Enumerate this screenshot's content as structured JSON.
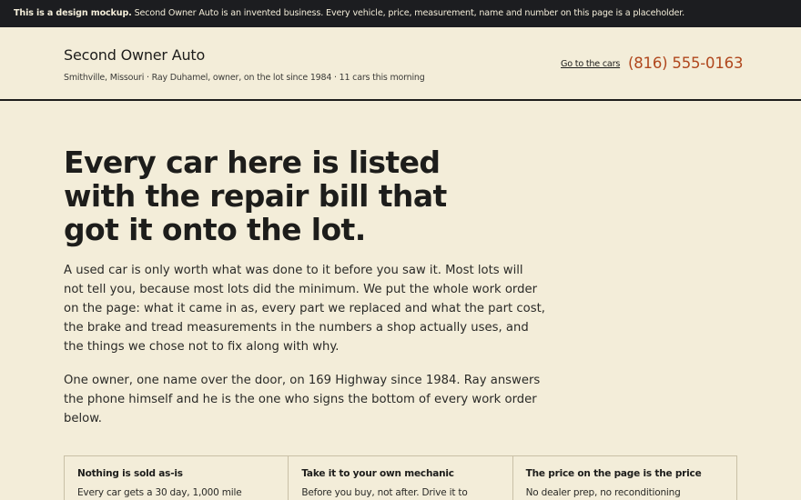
{
  "banner": {
    "lead": "This is a design mockup.",
    "text": "Second Owner Auto is an invented business. Every vehicle, price, measurement, name and number on this page is a placeholder."
  },
  "header": {
    "brand": "Second Owner Auto",
    "subline": "Smithville, Missouri · Ray Duhamel, owner, on the lot since 1984 · 11 cars this morning",
    "nav_link": "Go to the cars",
    "phone": "(816) 555-0163",
    "accent_color": "#b0471d"
  },
  "hero": {
    "title_lines": [
      "Every car here is listed",
      "with the repair bill that",
      "got it onto the lot."
    ],
    "para1_lines": [
      "A used car is only worth what was done to it before you saw it. Most lots will",
      "not tell you, because most lots did the minimum. We put the whole work order",
      "on the page: what it came in as, every part we replaced and what the part cost,",
      "the brake and tread measurements in the numbers a shop actually uses, and",
      "the things we chose not to fix along with why."
    ],
    "para2_lines": [
      "One owner, one name over the door, on 169 Highway since 1984. Ray answers",
      "the phone himself and he is the one who signs the bottom of every work order",
      "below."
    ]
  },
  "features": [
    {
      "title": "Nothing is sold as-is",
      "text": "Every car gets a 30 day, 1,000 mile"
    },
    {
      "title": "Take it to your own mechanic",
      "text": "Before you buy, not after. Drive it to"
    },
    {
      "title": "The price on the page is the price",
      "text": "No dealer prep, no reconditioning"
    }
  ]
}
